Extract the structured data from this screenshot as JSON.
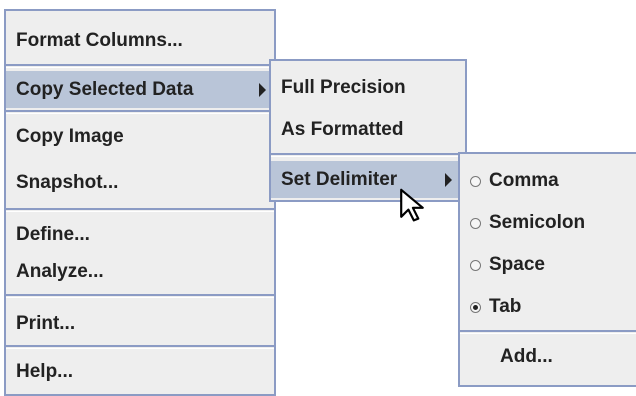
{
  "main_menu": {
    "items": [
      {
        "label": "Format Columns..."
      },
      {
        "label": "Copy Selected Data"
      },
      {
        "label": "Copy Image"
      },
      {
        "label": "Snapshot..."
      },
      {
        "label": "Define..."
      },
      {
        "label": "Analyze..."
      },
      {
        "label": "Print..."
      },
      {
        "label": "Help..."
      }
    ]
  },
  "copy_submenu": {
    "items": [
      {
        "label": "Full Precision"
      },
      {
        "label": "As Formatted"
      },
      {
        "label": "Set Delimiter"
      }
    ]
  },
  "delimiter_submenu": {
    "options": [
      {
        "label": "Comma",
        "checked": false
      },
      {
        "label": "Semicolon",
        "checked": false
      },
      {
        "label": "Space",
        "checked": false
      },
      {
        "label": "Tab",
        "checked": true
      }
    ],
    "add_label": "Add..."
  },
  "colors": {
    "menu_bg": "#eeeeee",
    "border": "#8b9bc4",
    "selected_bg": "#b9c5d8"
  },
  "icons": [
    "chevron-right-icon",
    "radio-icon",
    "pointer-cursor-icon"
  ]
}
